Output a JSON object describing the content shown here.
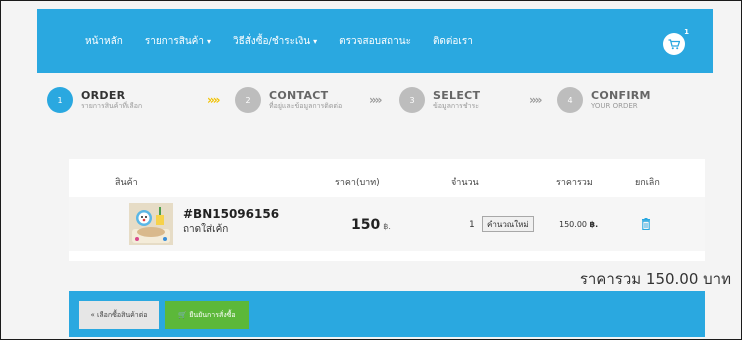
{
  "nav": {
    "links": [
      {
        "label": "หน้าหลัก",
        "caret": ""
      },
      {
        "label": "รายการสินค้า",
        "caret": "▾"
      },
      {
        "label": "วิธีสั่งซื้อ/ชำระเงิน",
        "caret": "▾"
      },
      {
        "label": "ตรวจสอบสถานะ",
        "caret": ""
      },
      {
        "label": "ติดต่อเรา",
        "caret": ""
      }
    ],
    "cart_count": "1",
    "cart_icon": "cart-icon"
  },
  "steps": [
    {
      "num": "1",
      "title": "ORDER",
      "sub": "รายการสินค้าที่เลือก",
      "active": true
    },
    {
      "num": "2",
      "title": "CONTACT",
      "sub": "ที่อยู่และข้อมูลการติดต่อ",
      "active": false
    },
    {
      "num": "3",
      "title": "SELECT",
      "sub": "ข้อมูลการชำระ",
      "active": false
    },
    {
      "num": "4",
      "title": "CONFIRM",
      "sub": "YOUR ORDER",
      "active": false
    }
  ],
  "arrow_glyph": "»»",
  "table": {
    "headers": {
      "product": "สินค้า",
      "price": "ราคา(บาท)",
      "qty": "จำนวน",
      "total": "ราคารวม",
      "cancel": "ยกเลิก"
    },
    "rows": [
      {
        "code": "#BN15096156",
        "name": "ถาดใส่เค้ก",
        "price": "150",
        "price_unit": "฿.",
        "qty": "1",
        "recalc_label": "คำนวณใหม่",
        "line_total": "150.00",
        "line_total_unit": "฿."
      }
    ]
  },
  "grand_total": "ราคารวม 150.00 บาท",
  "buttons": {
    "back": "« เลือกซื้อสินค้าต่อ",
    "confirm": "🛒 ยืนยันการสั่งซื้อ"
  },
  "colors": {
    "accent": "#2aa8e0",
    "confirm": "#5cb83a",
    "arrow_active": "#f2c200"
  }
}
